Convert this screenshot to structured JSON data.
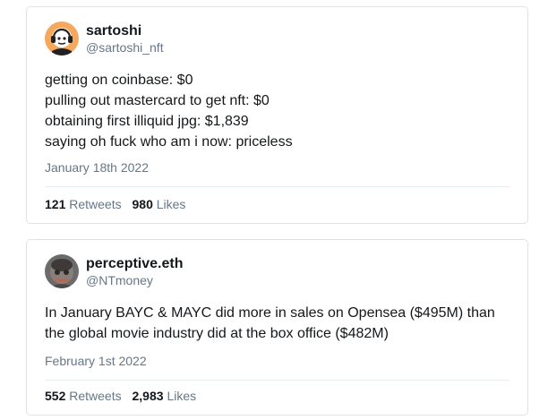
{
  "tweets": [
    {
      "display_name": "sartoshi",
      "handle": "@sartoshi_nft",
      "avatar_icon": "sartoshi-avatar-icon",
      "lines": [
        "getting on coinbase: $0",
        "pulling out mastercard to get nft: $0",
        "obtaining first illiquid jpg: $1,839",
        "saying oh fuck who am i now: priceless"
      ],
      "date": "January 18th 2022",
      "retweets": "121",
      "retweets_label": "Retweets",
      "likes": "980",
      "likes_label": "Likes"
    },
    {
      "display_name": "perceptive.eth",
      "handle": "@NTmoney",
      "avatar_icon": "perceptive-avatar-icon",
      "lines": [
        "In January BAYC & MAYC did more in sales on Opensea ($495M) than",
        "the global movie industry did at the box office ($482M)"
      ],
      "date": "February 1st 2022",
      "retweets": "552",
      "retweets_label": "Retweets",
      "likes": "2,983",
      "likes_label": "Likes"
    }
  ]
}
